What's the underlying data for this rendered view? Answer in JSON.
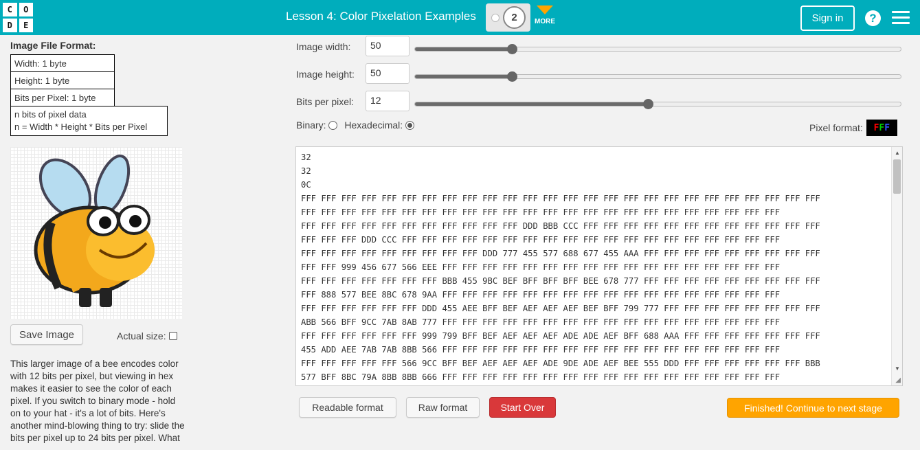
{
  "header": {
    "logo_letters": [
      "C",
      "O",
      "D",
      "E"
    ],
    "lesson_title": "Lesson 4: Color Pixelation Examples",
    "progress_current": "2",
    "more_label": "MORE",
    "signin_label": "Sign in",
    "help_glyph": "?",
    "colors": {
      "bar": "#00adbc",
      "more_arrow": "#ffa400"
    }
  },
  "format_panel": {
    "title": "Image File Format:",
    "width_row": "Width: 1 byte",
    "height_row": "Height: 1 byte",
    "bpp_row": "Bits per Pixel: 1 byte",
    "data_row_1": "n bits of pixel data",
    "data_row_2": "n = Width * Height * Bits per Pixel"
  },
  "left": {
    "save_image_label": "Save Image",
    "actual_size_label": "Actual size:",
    "actual_size_checked": false,
    "description": "This larger image of a bee encodes color with 12 bits per pixel, but viewing in hex makes it easier to see the color of each pixel. If you switch to binary mode - hold on to your hat - it's a lot of bits. Here's another mind-blowing thing to try: slide the bits per pixel up to 24 bits per pixel. What"
  },
  "controls": {
    "width_label": "Image width:",
    "width_value": "50",
    "width_fraction": 0.2,
    "height_label": "Image height:",
    "height_value": "50",
    "height_fraction": 0.2,
    "bpp_label": "Bits per pixel:",
    "bpp_value": "12",
    "bpp_fraction": 0.48,
    "binary_label": "Binary:",
    "hex_label": "Hexadecimal:",
    "selected_mode": "hexadecimal",
    "pixel_format_label": "Pixel format:",
    "pixel_format_chars": [
      {
        "ch": "F",
        "color": "#ff0000"
      },
      {
        "ch": "F",
        "color": "#00cc00"
      },
      {
        "ch": "F",
        "color": "#3355ff"
      }
    ]
  },
  "hex_data": {
    "lines": [
      "32",
      "32",
      "0C",
      "FFF FFF FFF FFF FFF FFF FFF FFF FFF FFF FFF FFF FFF FFF FFF FFF FFF FFF FFF FFF FFF FFF FFF FFF FFF FFF",
      "FFF FFF FFF FFF FFF FFF FFF FFF FFF FFF FFF FFF FFF FFF FFF FFF FFF FFF FFF FFF FFF FFF FFF FFF",
      "FFF FFF FFF FFF FFF FFF FFF FFF FFF FFF FFF DDD BBB CCC FFF FFF FFF FFF FFF FFF FFF FFF FFF FFF FFF FFF",
      "FFF FFF FFF DDD CCC FFF FFF FFF FFF FFF FFF FFF FFF FFF FFF FFF FFF FFF FFF FFF FFF FFF FFF FFF",
      "FFF FFF FFF FFF FFF FFF FFF FFF FFF DDD 777 455 577 688 677 455 AAA FFF FFF FFF FFF FFF FFF FFF FFF FFF",
      "FFF FFF 999 456 677 566 EEE FFF FFF FFF FFF FFF FFF FFF FFF FFF FFF FFF FFF FFF FFF FFF FFF FFF",
      "FFF FFF FFF FFF FFF FFF FFF BBB 455 9BC BEF BFF BFF BFF BEE 678 777 FFF FFF FFF FFF FFF FFF FFF FFF FFF",
      "FFF 888 577 BEE 8BC 678 9AA FFF FFF FFF FFF FFF FFF FFF FFF FFF FFF FFF FFF FFF FFF FFF FFF FFF",
      "FFF FFF FFF FFF FFF FFF DDD 455 AEE BFF BEF AEF AEF AEF BEF BFF 799 777 FFF FFF FFF FFF FFF FFF FFF FFF",
      "ABB 566 BFF 9CC 7AB 8AB 777 FFF FFF FFF FFF FFF FFF FFF FFF FFF FFF FFF FFF FFF FFF FFF FFF FFF",
      "FFF FFF FFF FFF FFF FFF 999 799 BFF BEF AEF AEF AEF ADE ADE AEF BFF 688 AAA FFF FFF FFF FFF FFF FFF FFF",
      "455 ADD AEE 7AB 7AB 8BB 566 FFF FFF FFF FFF FFF FFF FFF FFF FFF FFF FFF FFF FFF FFF FFF FFF FFF",
      "FFF FFF FFF FFF FFF 566 9CC BFF BEF AEF AEF AEF ADE 9DE ADE AEF BEE 555 DDD FFF FFF FFF FFF FFF FFF BBB",
      "577 BFF 8BC 79A 8BB 8BB 666 FFF FFF FFF FFF FFF FFF FFF FFF FFF FFF FFF FFF FFF FFF FFF FFF FFF"
    ]
  },
  "buttons": {
    "readable_label": "Readable format",
    "raw_label": "Raw format",
    "start_over_label": "Start Over",
    "finished_label": "Finished! Continue to next stage"
  }
}
